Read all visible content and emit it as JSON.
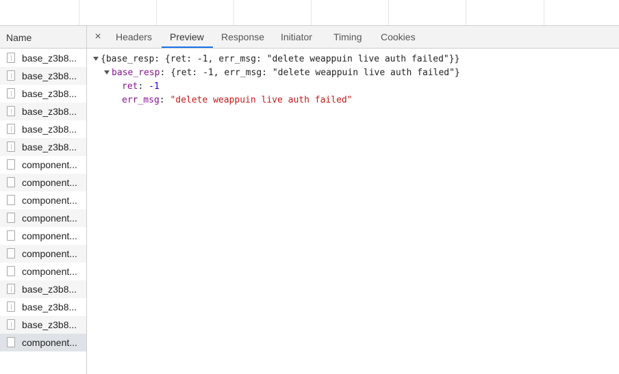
{
  "left_panel": {
    "header": "Name",
    "rows": [
      {
        "label": "base_z3b8...",
        "icon": "script-file-icon"
      },
      {
        "label": "base_z3b8...",
        "icon": "script-file-icon"
      },
      {
        "label": "base_z3b8...",
        "icon": "script-file-icon"
      },
      {
        "label": "base_z3b8...",
        "icon": "script-file-icon"
      },
      {
        "label": "base_z3b8...",
        "icon": "script-file-icon"
      },
      {
        "label": "base_z3b8...",
        "icon": "script-file-icon"
      },
      {
        "label": "component...",
        "icon": "document-file-icon"
      },
      {
        "label": "component...",
        "icon": "document-file-icon"
      },
      {
        "label": "component...",
        "icon": "document-file-icon"
      },
      {
        "label": "component...",
        "icon": "document-file-icon"
      },
      {
        "label": "component...",
        "icon": "document-file-icon"
      },
      {
        "label": "component...",
        "icon": "document-file-icon"
      },
      {
        "label": "component...",
        "icon": "document-file-icon"
      },
      {
        "label": "base_z3b8...",
        "icon": "script-file-icon"
      },
      {
        "label": "base_z3b8...",
        "icon": "script-file-icon"
      },
      {
        "label": "base_z3b8...",
        "icon": "script-file-icon"
      },
      {
        "label": "component...",
        "icon": "document-file-icon",
        "selected": true
      }
    ]
  },
  "tabs": {
    "close": "×",
    "items": [
      {
        "label": "Headers"
      },
      {
        "label": "Preview",
        "active": true
      },
      {
        "label": "Response"
      },
      {
        "label": "Initiator"
      },
      {
        "label": "Timing"
      },
      {
        "label": "Cookies"
      }
    ]
  },
  "preview": {
    "line1": {
      "open": "{",
      "key": "base_resp",
      "rest": ": {ret: -1, err_msg: \"delete weappuin live auth failed\"}}"
    },
    "line2": {
      "key": "base_resp",
      "rest": ": {ret: -1, err_msg: \"delete weappuin live auth failed\"}"
    },
    "line3": {
      "key": "ret",
      "sep": ": ",
      "value": "-1"
    },
    "line4": {
      "key": "err_msg",
      "sep": ": ",
      "value": "\"delete weappuin live auth failed\""
    }
  },
  "colors": {
    "accent": "#1a73e8",
    "json_key": "#881391",
    "json_number": "#1c00cf",
    "json_string": "#c41a16"
  }
}
